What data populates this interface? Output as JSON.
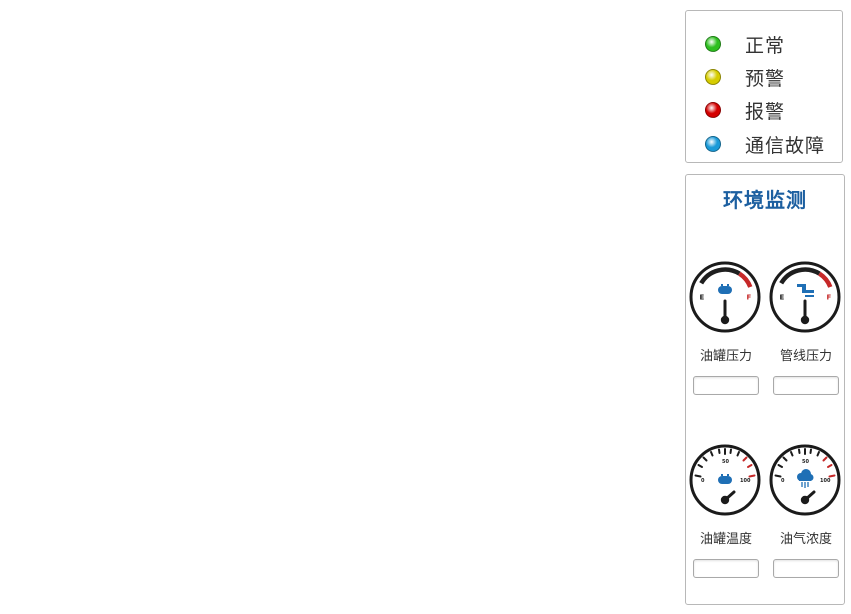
{
  "legend": {
    "items": [
      {
        "key": "normal",
        "label": "正常",
        "color": "#2dbf1f"
      },
      {
        "key": "warning",
        "label": "预警",
        "color": "#d6cc00"
      },
      {
        "key": "alarm",
        "label": "报警",
        "color": "#d40000"
      },
      {
        "key": "comm_fault",
        "label": "通信故障",
        "color": "#1a9ad8"
      }
    ]
  },
  "env_monitor": {
    "title": "环境监测",
    "gauges": [
      {
        "key": "tank_pressure",
        "label": "油罐压力",
        "value": "",
        "icon": "oil-tank-icon",
        "scale_start": "E",
        "scale_end": "F"
      },
      {
        "key": "pipeline_pressure",
        "label": "管线压力",
        "value": "",
        "icon": "pipeline-icon",
        "scale_start": "E",
        "scale_end": "F"
      },
      {
        "key": "tank_temperature",
        "label": "油罐温度",
        "value": "",
        "icon": "oil-tank-icon",
        "scale_start": "0",
        "scale_mid": "50",
        "scale_end": "100"
      },
      {
        "key": "gas_concentration",
        "label": "油气浓度",
        "value": "",
        "icon": "gas-cloud-icon",
        "scale_start": "0",
        "scale_mid": "50",
        "scale_end": "100"
      }
    ]
  }
}
